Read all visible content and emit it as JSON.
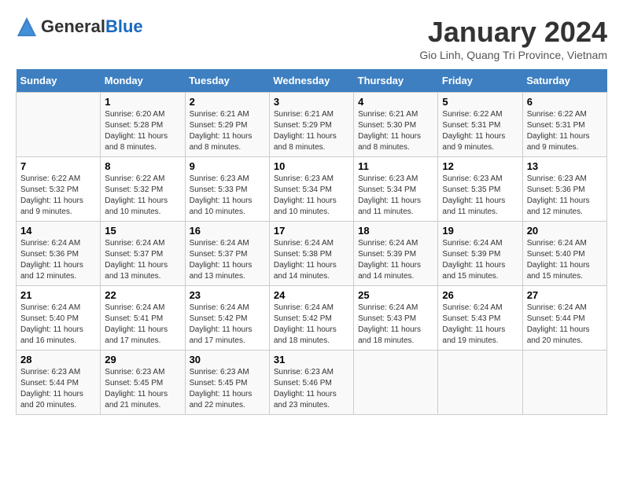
{
  "header": {
    "title": "January 2024",
    "location": "Gio Linh, Quang Tri Province, Vietnam",
    "logo_general": "General",
    "logo_blue": "Blue"
  },
  "days_of_week": [
    "Sunday",
    "Monday",
    "Tuesday",
    "Wednesday",
    "Thursday",
    "Friday",
    "Saturday"
  ],
  "weeks": [
    [
      {
        "num": "",
        "sunrise": "",
        "sunset": "",
        "daylight": ""
      },
      {
        "num": "1",
        "sunrise": "Sunrise: 6:20 AM",
        "sunset": "Sunset: 5:28 PM",
        "daylight": "Daylight: 11 hours and 8 minutes."
      },
      {
        "num": "2",
        "sunrise": "Sunrise: 6:21 AM",
        "sunset": "Sunset: 5:29 PM",
        "daylight": "Daylight: 11 hours and 8 minutes."
      },
      {
        "num": "3",
        "sunrise": "Sunrise: 6:21 AM",
        "sunset": "Sunset: 5:29 PM",
        "daylight": "Daylight: 11 hours and 8 minutes."
      },
      {
        "num": "4",
        "sunrise": "Sunrise: 6:21 AM",
        "sunset": "Sunset: 5:30 PM",
        "daylight": "Daylight: 11 hours and 8 minutes."
      },
      {
        "num": "5",
        "sunrise": "Sunrise: 6:22 AM",
        "sunset": "Sunset: 5:31 PM",
        "daylight": "Daylight: 11 hours and 9 minutes."
      },
      {
        "num": "6",
        "sunrise": "Sunrise: 6:22 AM",
        "sunset": "Sunset: 5:31 PM",
        "daylight": "Daylight: 11 hours and 9 minutes."
      }
    ],
    [
      {
        "num": "7",
        "sunrise": "Sunrise: 6:22 AM",
        "sunset": "Sunset: 5:32 PM",
        "daylight": "Daylight: 11 hours and 9 minutes."
      },
      {
        "num": "8",
        "sunrise": "Sunrise: 6:22 AM",
        "sunset": "Sunset: 5:32 PM",
        "daylight": "Daylight: 11 hours and 10 minutes."
      },
      {
        "num": "9",
        "sunrise": "Sunrise: 6:23 AM",
        "sunset": "Sunset: 5:33 PM",
        "daylight": "Daylight: 11 hours and 10 minutes."
      },
      {
        "num": "10",
        "sunrise": "Sunrise: 6:23 AM",
        "sunset": "Sunset: 5:34 PM",
        "daylight": "Daylight: 11 hours and 10 minutes."
      },
      {
        "num": "11",
        "sunrise": "Sunrise: 6:23 AM",
        "sunset": "Sunset: 5:34 PM",
        "daylight": "Daylight: 11 hours and 11 minutes."
      },
      {
        "num": "12",
        "sunrise": "Sunrise: 6:23 AM",
        "sunset": "Sunset: 5:35 PM",
        "daylight": "Daylight: 11 hours and 11 minutes."
      },
      {
        "num": "13",
        "sunrise": "Sunrise: 6:23 AM",
        "sunset": "Sunset: 5:36 PM",
        "daylight": "Daylight: 11 hours and 12 minutes."
      }
    ],
    [
      {
        "num": "14",
        "sunrise": "Sunrise: 6:24 AM",
        "sunset": "Sunset: 5:36 PM",
        "daylight": "Daylight: 11 hours and 12 minutes."
      },
      {
        "num": "15",
        "sunrise": "Sunrise: 6:24 AM",
        "sunset": "Sunset: 5:37 PM",
        "daylight": "Daylight: 11 hours and 13 minutes."
      },
      {
        "num": "16",
        "sunrise": "Sunrise: 6:24 AM",
        "sunset": "Sunset: 5:37 PM",
        "daylight": "Daylight: 11 hours and 13 minutes."
      },
      {
        "num": "17",
        "sunrise": "Sunrise: 6:24 AM",
        "sunset": "Sunset: 5:38 PM",
        "daylight": "Daylight: 11 hours and 14 minutes."
      },
      {
        "num": "18",
        "sunrise": "Sunrise: 6:24 AM",
        "sunset": "Sunset: 5:39 PM",
        "daylight": "Daylight: 11 hours and 14 minutes."
      },
      {
        "num": "19",
        "sunrise": "Sunrise: 6:24 AM",
        "sunset": "Sunset: 5:39 PM",
        "daylight": "Daylight: 11 hours and 15 minutes."
      },
      {
        "num": "20",
        "sunrise": "Sunrise: 6:24 AM",
        "sunset": "Sunset: 5:40 PM",
        "daylight": "Daylight: 11 hours and 15 minutes."
      }
    ],
    [
      {
        "num": "21",
        "sunrise": "Sunrise: 6:24 AM",
        "sunset": "Sunset: 5:40 PM",
        "daylight": "Daylight: 11 hours and 16 minutes."
      },
      {
        "num": "22",
        "sunrise": "Sunrise: 6:24 AM",
        "sunset": "Sunset: 5:41 PM",
        "daylight": "Daylight: 11 hours and 17 minutes."
      },
      {
        "num": "23",
        "sunrise": "Sunrise: 6:24 AM",
        "sunset": "Sunset: 5:42 PM",
        "daylight": "Daylight: 11 hours and 17 minutes."
      },
      {
        "num": "24",
        "sunrise": "Sunrise: 6:24 AM",
        "sunset": "Sunset: 5:42 PM",
        "daylight": "Daylight: 11 hours and 18 minutes."
      },
      {
        "num": "25",
        "sunrise": "Sunrise: 6:24 AM",
        "sunset": "Sunset: 5:43 PM",
        "daylight": "Daylight: 11 hours and 18 minutes."
      },
      {
        "num": "26",
        "sunrise": "Sunrise: 6:24 AM",
        "sunset": "Sunset: 5:43 PM",
        "daylight": "Daylight: 11 hours and 19 minutes."
      },
      {
        "num": "27",
        "sunrise": "Sunrise: 6:24 AM",
        "sunset": "Sunset: 5:44 PM",
        "daylight": "Daylight: 11 hours and 20 minutes."
      }
    ],
    [
      {
        "num": "28",
        "sunrise": "Sunrise: 6:23 AM",
        "sunset": "Sunset: 5:44 PM",
        "daylight": "Daylight: 11 hours and 20 minutes."
      },
      {
        "num": "29",
        "sunrise": "Sunrise: 6:23 AM",
        "sunset": "Sunset: 5:45 PM",
        "daylight": "Daylight: 11 hours and 21 minutes."
      },
      {
        "num": "30",
        "sunrise": "Sunrise: 6:23 AM",
        "sunset": "Sunset: 5:45 PM",
        "daylight": "Daylight: 11 hours and 22 minutes."
      },
      {
        "num": "31",
        "sunrise": "Sunrise: 6:23 AM",
        "sunset": "Sunset: 5:46 PM",
        "daylight": "Daylight: 11 hours and 23 minutes."
      },
      {
        "num": "",
        "sunrise": "",
        "sunset": "",
        "daylight": ""
      },
      {
        "num": "",
        "sunrise": "",
        "sunset": "",
        "daylight": ""
      },
      {
        "num": "",
        "sunrise": "",
        "sunset": "",
        "daylight": ""
      }
    ]
  ]
}
